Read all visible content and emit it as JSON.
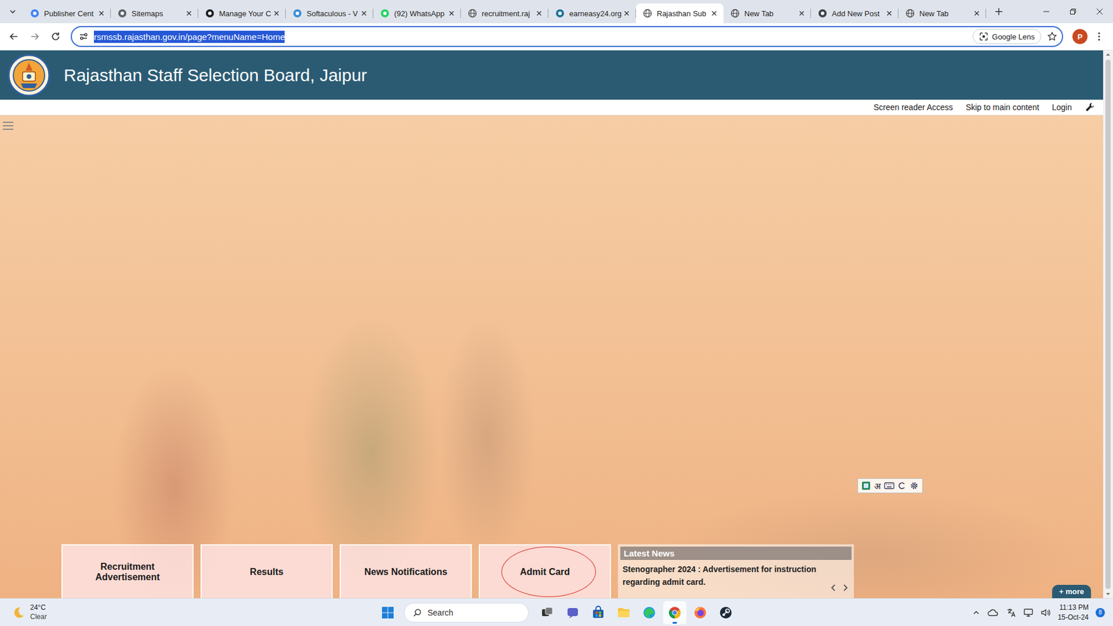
{
  "browser": {
    "tabs": [
      {
        "label": "Publisher Cent",
        "kind": "google",
        "selected": false
      },
      {
        "label": "Sitemaps",
        "kind": "sitemaps",
        "selected": false
      },
      {
        "label": "Manage Your C",
        "kind": "adsense",
        "selected": false
      },
      {
        "label": "Softaculous - V",
        "kind": "softaculous",
        "selected": false
      },
      {
        "label": "(92) WhatsApp",
        "kind": "whatsapp",
        "selected": false
      },
      {
        "label": "recruitment.raj",
        "kind": "globe",
        "selected": false
      },
      {
        "label": "earneasy24.org",
        "kind": "wordpress",
        "selected": false
      },
      {
        "label": "Rajasthan Sub",
        "kind": "globe",
        "selected": true
      },
      {
        "label": "New Tab",
        "kind": "globe",
        "selected": false
      },
      {
        "label": "Add New Post",
        "kind": "wordpress-admin",
        "selected": false
      },
      {
        "label": "New Tab",
        "kind": "globe",
        "selected": false
      }
    ],
    "address": {
      "url": "rsmssb.rajasthan.gov.in/page?menuName=Home",
      "selected": true
    },
    "lens_label": "Google Lens",
    "profile_initial": "P"
  },
  "site": {
    "title": "Rajasthan Staff Selection Board, Jaipur",
    "top_links": [
      "Screen reader Access",
      "Skip to main content",
      "Login"
    ],
    "input_tool": {
      "script_label": "अ"
    },
    "tiles": [
      {
        "label": "Recruitment Advertisement",
        "circled": false
      },
      {
        "label": "Results",
        "circled": false
      },
      {
        "label": "News Notifications",
        "circled": false
      },
      {
        "label": "Admit Card",
        "circled": true
      }
    ],
    "news": {
      "title": "Latest News",
      "items": [
        "Stenographer 2024 : Advertisement for instruction regarding admit card."
      ],
      "more_label": "+ more"
    }
  },
  "taskbar": {
    "weather": {
      "temperature": "24°C",
      "condition": "Clear"
    },
    "search_placeholder": "Search",
    "apps": [
      {
        "kind": "task-view",
        "active": false
      },
      {
        "kind": "teams",
        "active": false
      },
      {
        "kind": "store",
        "active": false
      },
      {
        "kind": "explorer",
        "active": false
      },
      {
        "kind": "edge",
        "active": false
      },
      {
        "kind": "chrome",
        "active": true
      },
      {
        "kind": "firefox",
        "active": false
      },
      {
        "kind": "steam",
        "active": false
      }
    ],
    "clock": {
      "time": "11:13 PM",
      "date": "15-Oct-24"
    },
    "notification_count": "8"
  }
}
